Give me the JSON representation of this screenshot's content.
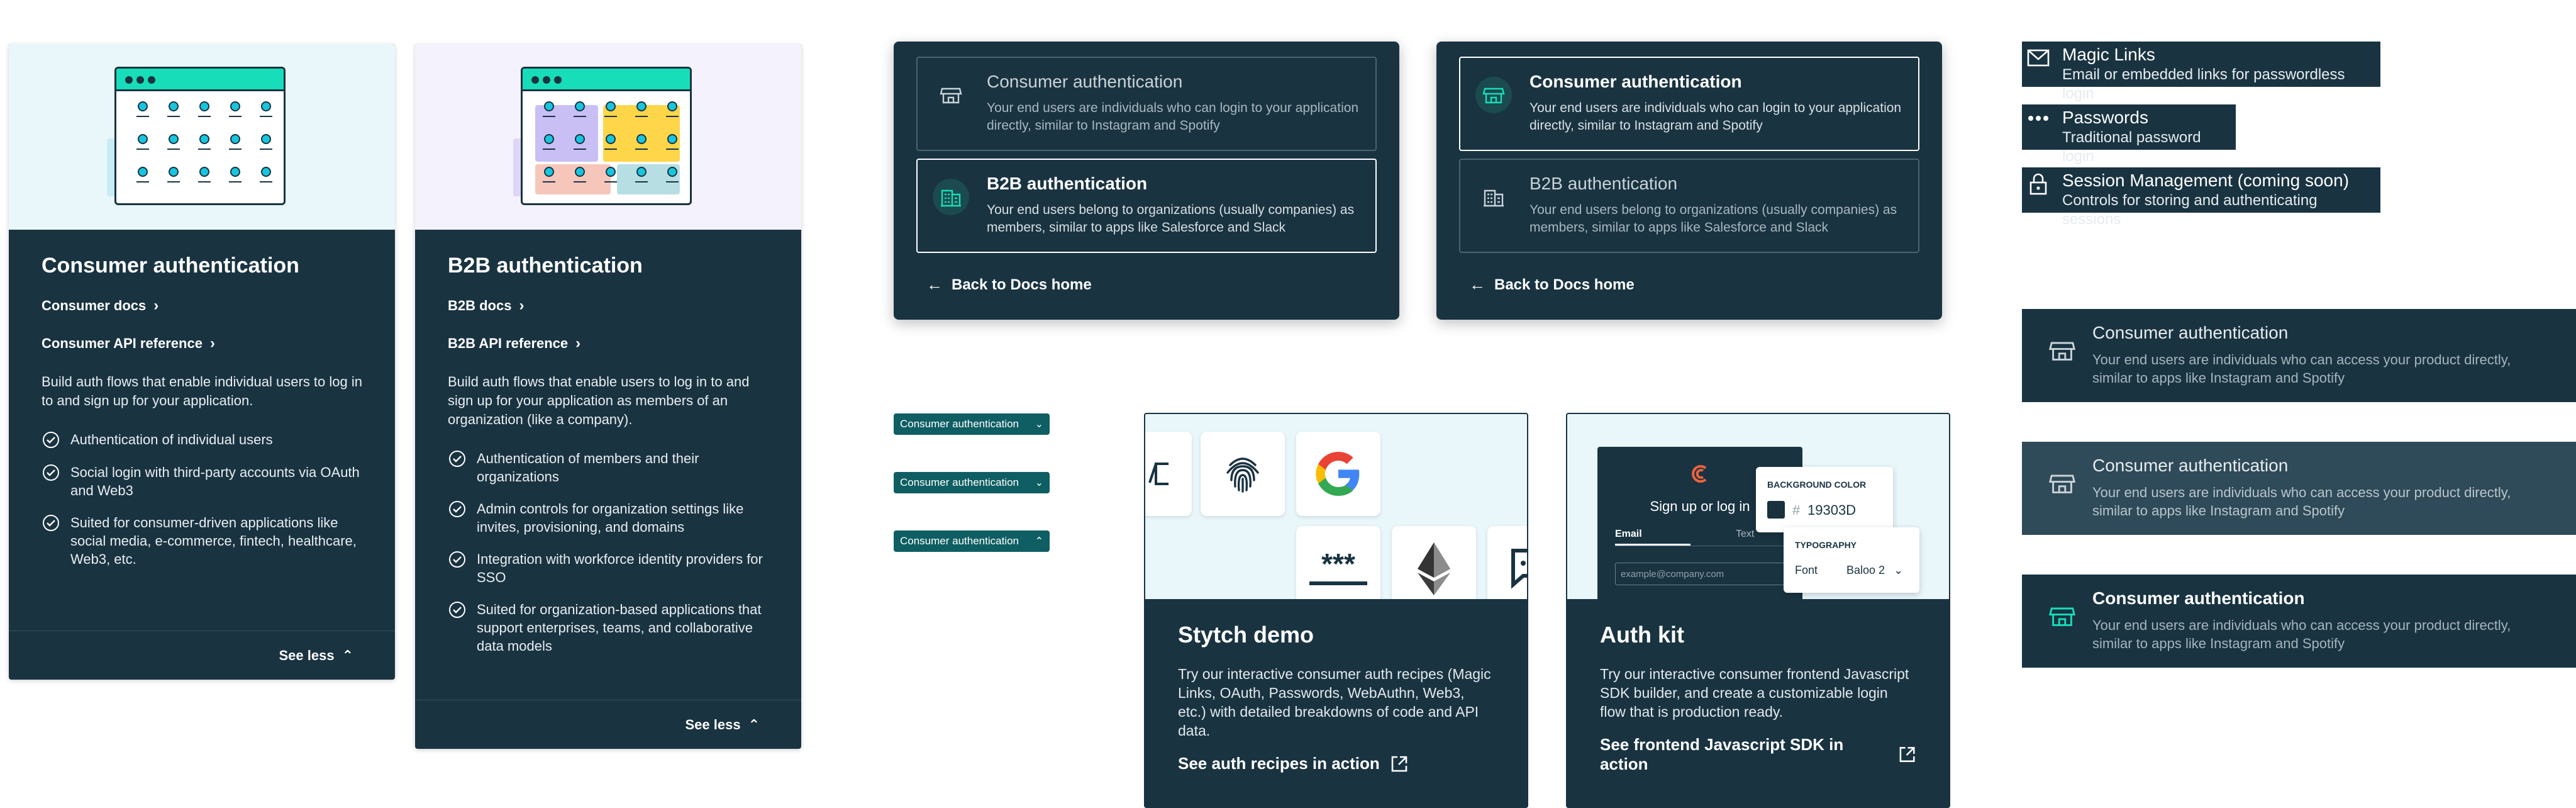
{
  "consumer_card": {
    "title": "Consumer authentication",
    "docs_link": "Consumer docs",
    "api_link": "Consumer API reference",
    "description": "Build auth flows that enable individual users to log in to and sign up for your application.",
    "features": [
      "Authentication of individual users",
      "Social login with third-party accounts via OAuth and Web3",
      "Suited for consumer-driven applications like social media, e-commerce, fintech, healthcare, Web3, etc."
    ],
    "see_less": "See less"
  },
  "b2b_card": {
    "title": "B2B authentication",
    "docs_link": "B2B docs",
    "api_link": "B2B API reference",
    "description": "Build auth flows that enable users to log in to and sign up for your application as members of an organization (like a company).",
    "features": [
      "Authentication of members and their organizations",
      "Admin controls for organization settings like invites, provisioning, and domains",
      "Integration with workforce identity providers for SSO",
      "Suited for organization-based applications that support enterprises, teams, and collaborative data models"
    ],
    "see_less": "See less"
  },
  "switcher": {
    "consumer_title": "Consumer authentication",
    "consumer_desc": "Your end users are individuals who can login to your application directly, similar to Instagram and Spotify",
    "b2b_title": "B2B authentication",
    "b2b_desc": "Your end users belong to organizations (usually companies) as members, similar to apps like Salesforce and Slack",
    "back_label": "Back to Docs home"
  },
  "pills": [
    "Consumer authentication",
    "Consumer authentication",
    "Consumer authentication"
  ],
  "stytch_demo": {
    "title": "Stytch demo",
    "description": "Try our interactive consumer auth recipes (Magic Links, OAuth, Passwords, WebAuthn, Web3, etc.) with detailed breakdowns of code and API data.",
    "action": "See auth recipes in action",
    "password_mask": "***"
  },
  "auth_kit": {
    "title": "Auth kit",
    "description": "Try our interactive consumer frontend Javascript SDK builder, and create a customizable login flow that is production ready.",
    "action": "See frontend Javascript SDK in action",
    "preview": {
      "heading": "Sign up or log in",
      "tab_email": "Email",
      "tab_text": "Text",
      "input_placeholder": "example@company.com",
      "bg_label": "BACKGROUND COLOR",
      "hash": "#",
      "bg_value": "19303D",
      "typo_label": "TYPOGRAPHY",
      "font_label": "Font",
      "font_value": "Baloo 2"
    }
  },
  "product_list": [
    {
      "title": "Magic Links",
      "desc": "Email or embedded links for passwordless login",
      "icon": "envelope-icon"
    },
    {
      "title": "Passwords",
      "desc": "Traditional password login",
      "icon": "password-dots-icon"
    },
    {
      "title": "Session Management (coming soon)",
      "desc": "Controls for storing and authenticating sessions",
      "icon": "lock-icon"
    }
  ],
  "state_cards": [
    {
      "title": "Consumer authentication",
      "desc": "Your end users are individuals who can access your product directly, similar to apps like Instagram and Spotify"
    },
    {
      "title": "Consumer authentication",
      "desc": "Your end users are individuals who can access your product directly, similar to apps like Instagram and Spotify"
    },
    {
      "title": "Consumer authentication",
      "desc": "Your end users are individuals who can access your product directly, similar to apps like Instagram and Spotify"
    }
  ],
  "colors": {
    "navy": "#193341",
    "teal": "#18ddb9",
    "pill": "#0f5e63",
    "hover": "#2f4a58",
    "light_blue": "#e9f7fb",
    "light_purple": "#f4f2fd"
  }
}
